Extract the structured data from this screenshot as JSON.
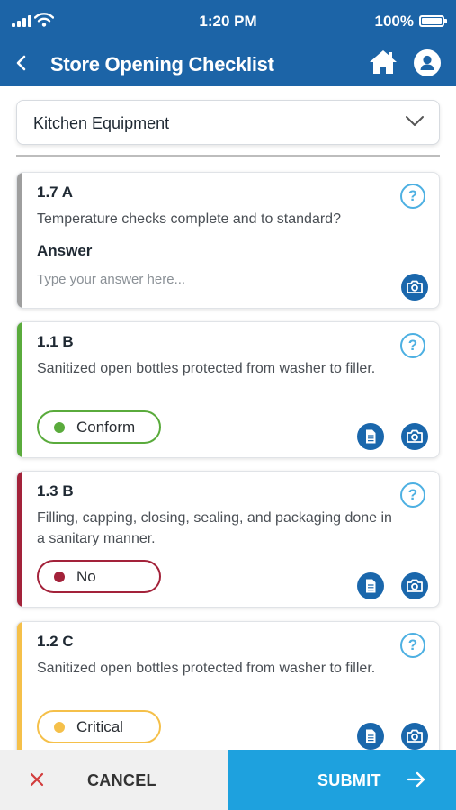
{
  "status_bar": {
    "time": "1:20 PM",
    "battery": "100%"
  },
  "header": {
    "title": "Store Opening Checklist"
  },
  "category_select": {
    "selected": "Kitchen Equipment"
  },
  "items": [
    {
      "code": "1.7 A",
      "question": "Temperature checks complete and to standard?",
      "answer_label": "Answer",
      "answer_placeholder": "Type your answer here...",
      "bar_color": "#9e9e9e"
    },
    {
      "code": "1.1 B",
      "question": "Sanitized open bottles protected from washer to filler.",
      "status": "Conform",
      "bar_color": "#5aab3c"
    },
    {
      "code": "1.3 B",
      "question": "Filling, capping, closing, sealing, and packaging done in a sanitary manner.",
      "status": "No",
      "bar_color": "#a3223a"
    },
    {
      "code": "1.2 C",
      "question": "Sanitized open bottles protected from washer to filler.",
      "status": "Critical",
      "bar_color": "#f5c04a"
    }
  ],
  "help_symbol": "?",
  "footer": {
    "cancel_label": "CANCEL",
    "submit_label": "SUBMIT"
  },
  "colors": {
    "header": "#1c64a7",
    "accent": "#1ea1de",
    "conform": "#5aab3c",
    "no": "#a3223a",
    "critical": "#f5c04a"
  }
}
